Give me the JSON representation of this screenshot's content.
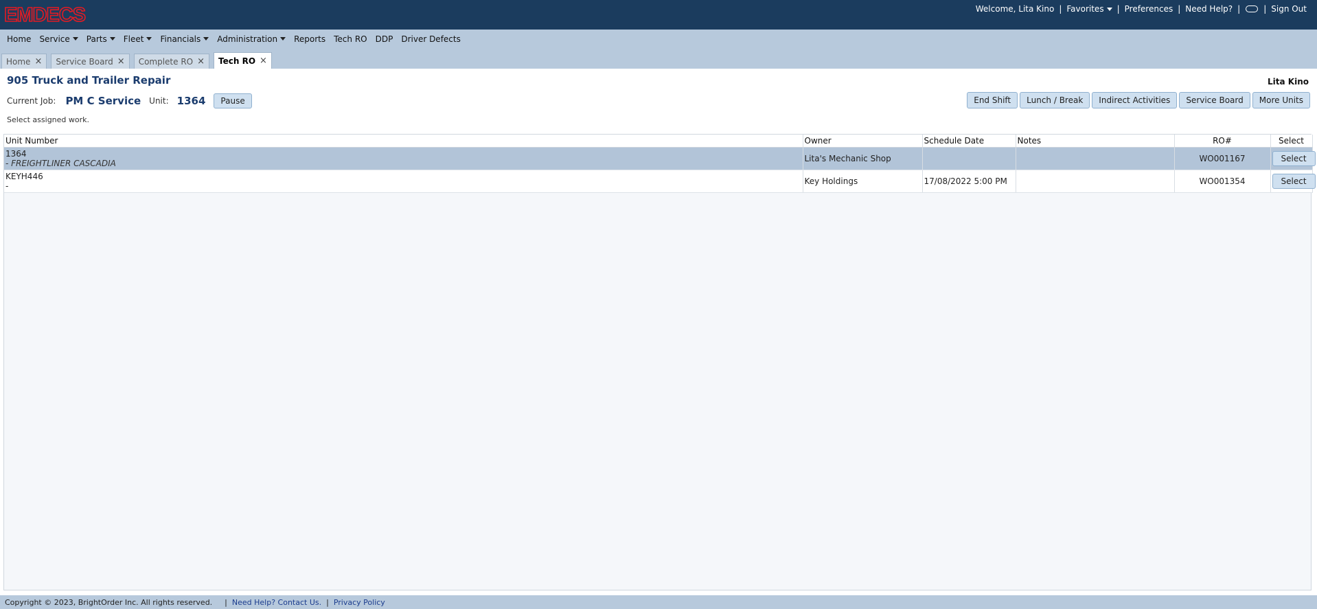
{
  "brand": {
    "logo_text": "EMDECS",
    "logo_color": "#e31b23"
  },
  "header": {
    "welcome": "Welcome, Lita Kino",
    "favorites": "Favorites",
    "preferences": "Preferences",
    "need_help": "Need Help?",
    "sign_out": "Sign Out",
    "separator": "|"
  },
  "nav": {
    "items": [
      "Home",
      "Service",
      "Parts",
      "Fleet",
      "Financials",
      "Administration",
      "Reports",
      "Tech RO",
      "DDP",
      "Driver Defects"
    ]
  },
  "tabs": [
    {
      "label": "Home",
      "close": "×"
    },
    {
      "label": "Service Board",
      "close": "×"
    },
    {
      "label": "Complete RO",
      "close": "×"
    },
    {
      "label": "Tech RO",
      "close": "×",
      "active": true
    }
  ],
  "main": {
    "shop_title": "905 Truck and Trailer Repair",
    "user_name": "Lita Kino",
    "current_job_label": "Current Job:",
    "current_job": "PM C Service",
    "unit_label": "Unit:",
    "unit_value": "1364",
    "pause_label": "Pause",
    "hint": "Select assigned work.",
    "actions": [
      "End Shift",
      "Lunch / Break",
      "Indirect Activities",
      "Service Board",
      "More Units"
    ]
  },
  "grid": {
    "columns": [
      "Unit Number",
      "Owner",
      "Schedule Date",
      "Notes",
      "RO#",
      "Select"
    ],
    "rows": [
      {
        "unit": "1364",
        "unit_desc": "- FREIGHTLINER CASCADIA",
        "owner": "Lita's Mechanic Shop",
        "schedule": "",
        "notes": "",
        "ro": "WO001167",
        "select": "Select",
        "selected": true
      },
      {
        "unit": "KEYH446",
        "unit_desc": "-",
        "owner": "Key Holdings",
        "schedule": "17/08/2022 5:00 PM",
        "notes": "",
        "ro": "WO001354",
        "select": "Select",
        "selected": false
      }
    ]
  },
  "footer": {
    "copyright": "Copyright © 2023, BrightOrder Inc. All rights reserved.",
    "help_link": "Need Help? Contact Us.",
    "privacy_link": "Privacy Policy",
    "separator": "|"
  }
}
